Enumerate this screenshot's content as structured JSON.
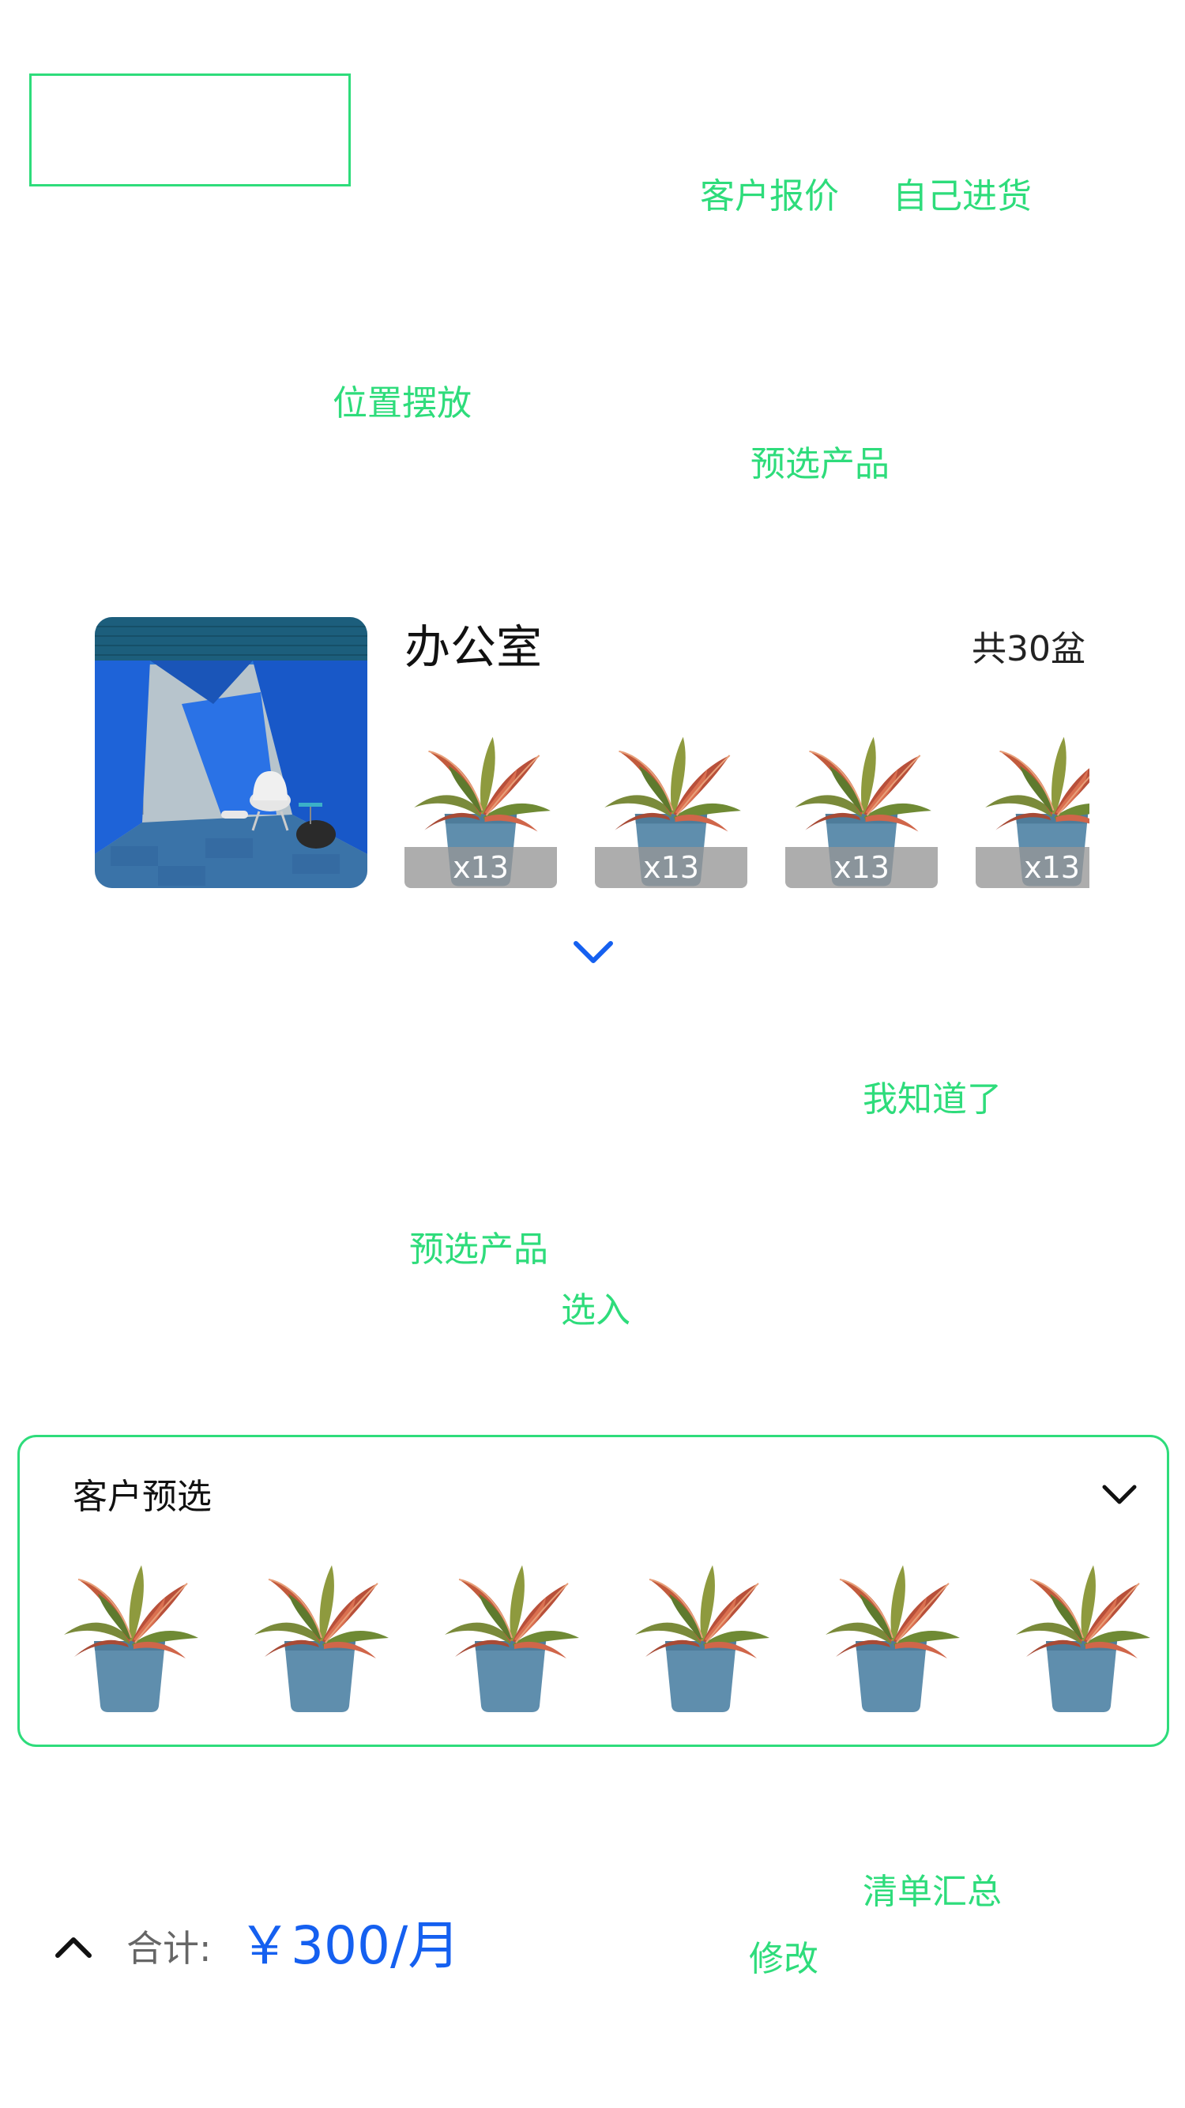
{
  "header": {
    "tab_quote": "客户报价",
    "tab_purchase": "自己进货"
  },
  "annotations": {
    "position_layout": "位置摆放",
    "preselect_product": "预选产品",
    "got_it": "我知道了",
    "preselect_product_2": "预选产品",
    "select_in": "选入",
    "list_summary": "清单汇总",
    "modify": "修改"
  },
  "room": {
    "name": "办公室",
    "total": "共30盆",
    "items": [
      {
        "count": "x13"
      },
      {
        "count": "x13"
      },
      {
        "count": "x13"
      },
      {
        "count": "x13"
      }
    ]
  },
  "preselect": {
    "title": "客户预选",
    "plant_count": 6
  },
  "summary": {
    "label": "合计:",
    "amount": "￥300/月"
  },
  "colors": {
    "accent_green": "#2EDC7B",
    "primary_blue": "#1560F0",
    "count_overlay": "#969696"
  },
  "icons": {
    "expand": "chevron-down-icon",
    "collapse": "chevron-up-icon"
  }
}
